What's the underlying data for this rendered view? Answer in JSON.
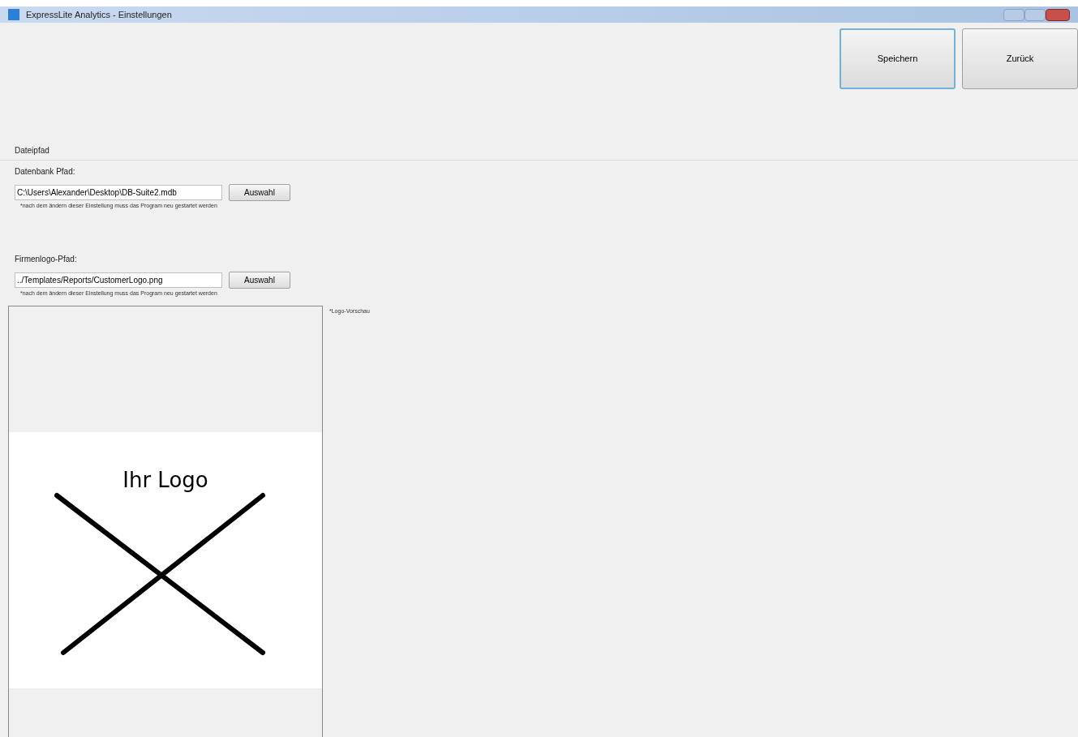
{
  "window": {
    "title": "ExpressLite Analytics - Einstellungen"
  },
  "toolbar": {
    "buttons": [
      {
        "label": "Speichern",
        "focused": true
      },
      {
        "label": "Zurück",
        "focused": false
      }
    ]
  },
  "section": {
    "title": "Dateipfad"
  },
  "fields": [
    {
      "label": "Datenbank Pfad:",
      "value": "C:\\Users\\Alexander\\Desktop\\DB-Suite2.mdb",
      "button": "Auswahl",
      "note": "*nach dem ändern dieser Einstellung muss das Program neu gestartet werden"
    },
    {
      "label": "Firmenlogo-Pfad:",
      "value": "../Templates/Reports/CustomerLogo.png",
      "button": "Auswahl",
      "note": "*nach dem ändern dieser Einstellung muss das Program neu gestartet werden"
    }
  ],
  "preview": {
    "caption": "*Logo-Vorschau",
    "logo_text": "Ihr Logo"
  }
}
